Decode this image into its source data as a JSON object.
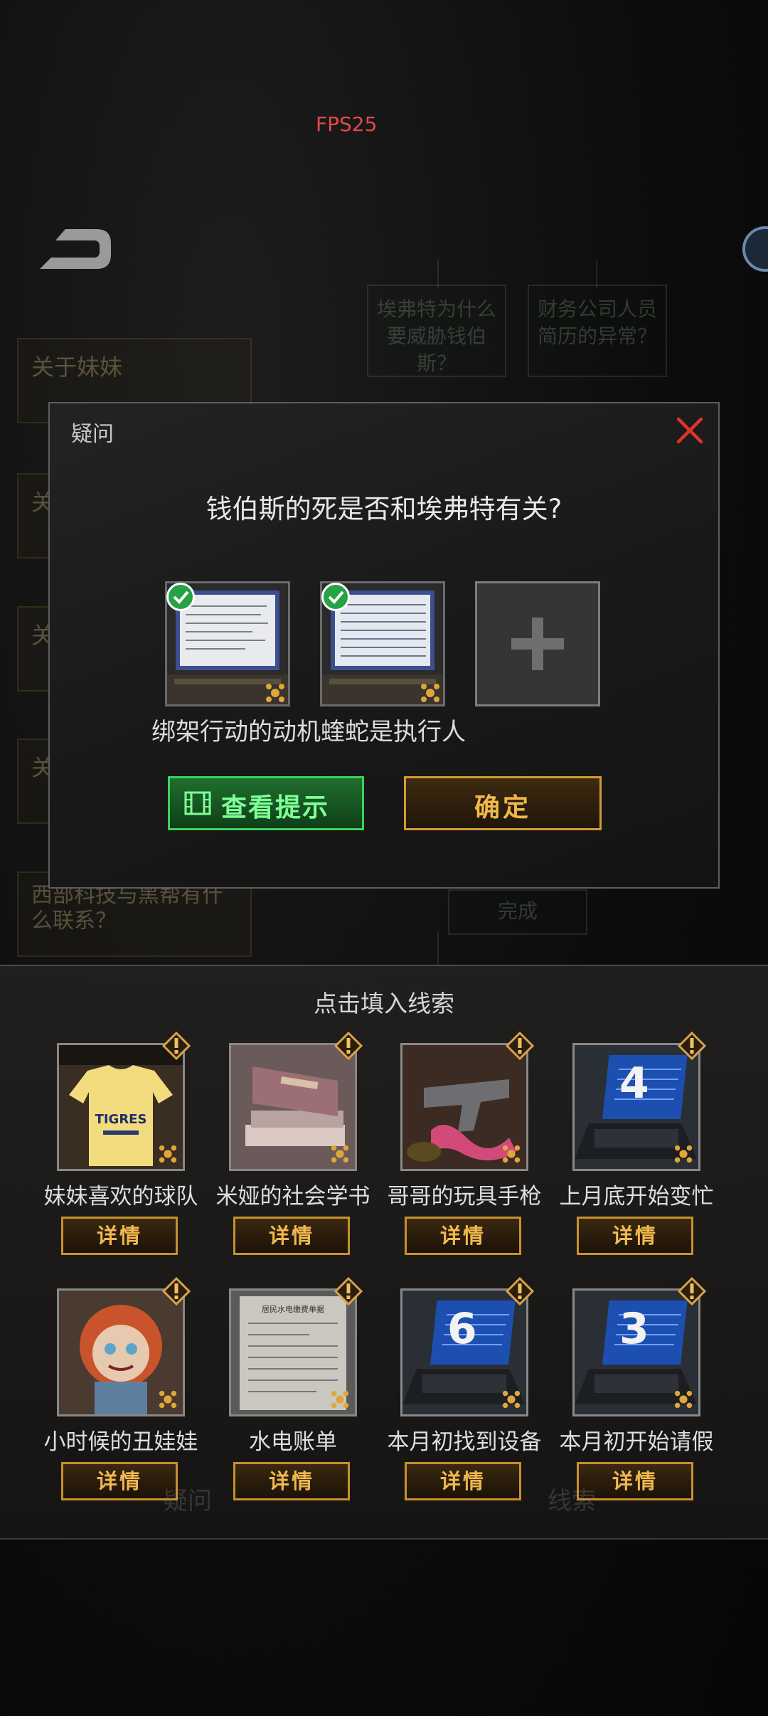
{
  "hud": {
    "fps": "FPS25"
  },
  "background": {
    "nodes_right": [
      "埃弗特为什么要威胁钱伯斯？",
      "财务公司人员简历的异常？"
    ],
    "left_items": [
      "关于妹妹",
      "关",
      "关",
      "关",
      "西部科技与黑帮有什么联系？"
    ],
    "complete_text": "完成",
    "bottom_tabs": [
      "疑问",
      "线索"
    ]
  },
  "dialog": {
    "title": "疑问",
    "question": "钱伯斯的死是否和埃弗特有关?",
    "slots": [
      {
        "filled": true,
        "icon": "computer-screen-clue"
      },
      {
        "filled": true,
        "icon": "computer-screen-clue"
      },
      {
        "filled": false,
        "icon": "plus-icon"
      }
    ],
    "selected_clues_text": "绑架行动的动机蝰蛇是执行人",
    "hint_button": "查看提示",
    "confirm_button": "确定"
  },
  "clue_panel": {
    "title": "点击填入线索",
    "detail_label": "详情",
    "clues": [
      {
        "name": "妹妹喜欢的球队",
        "art": "tigres-jersey",
        "number": ""
      },
      {
        "name": "米娅的社会学书",
        "art": "books",
        "number": ""
      },
      {
        "name": "哥哥的玩具手枪",
        "art": "toy-pistol",
        "number": ""
      },
      {
        "name": "上月底开始变忙",
        "art": "laptop",
        "number": "4"
      },
      {
        "name": "小时候的丑娃娃",
        "art": "doll",
        "number": ""
      },
      {
        "name": "水电账单",
        "art": "bill",
        "number": ""
      },
      {
        "name": "本月初找到设备",
        "art": "laptop",
        "number": "6"
      },
      {
        "name": "本月初开始请假",
        "art": "laptop",
        "number": "3"
      }
    ],
    "jersey_text": "TIGRES",
    "bill_title": "居民水电缴费单据"
  },
  "colors": {
    "accent_gold": "#d39a33",
    "hint_green": "#3cd35a",
    "close_red": "#e0332b",
    "fps_red": "#e54848"
  }
}
